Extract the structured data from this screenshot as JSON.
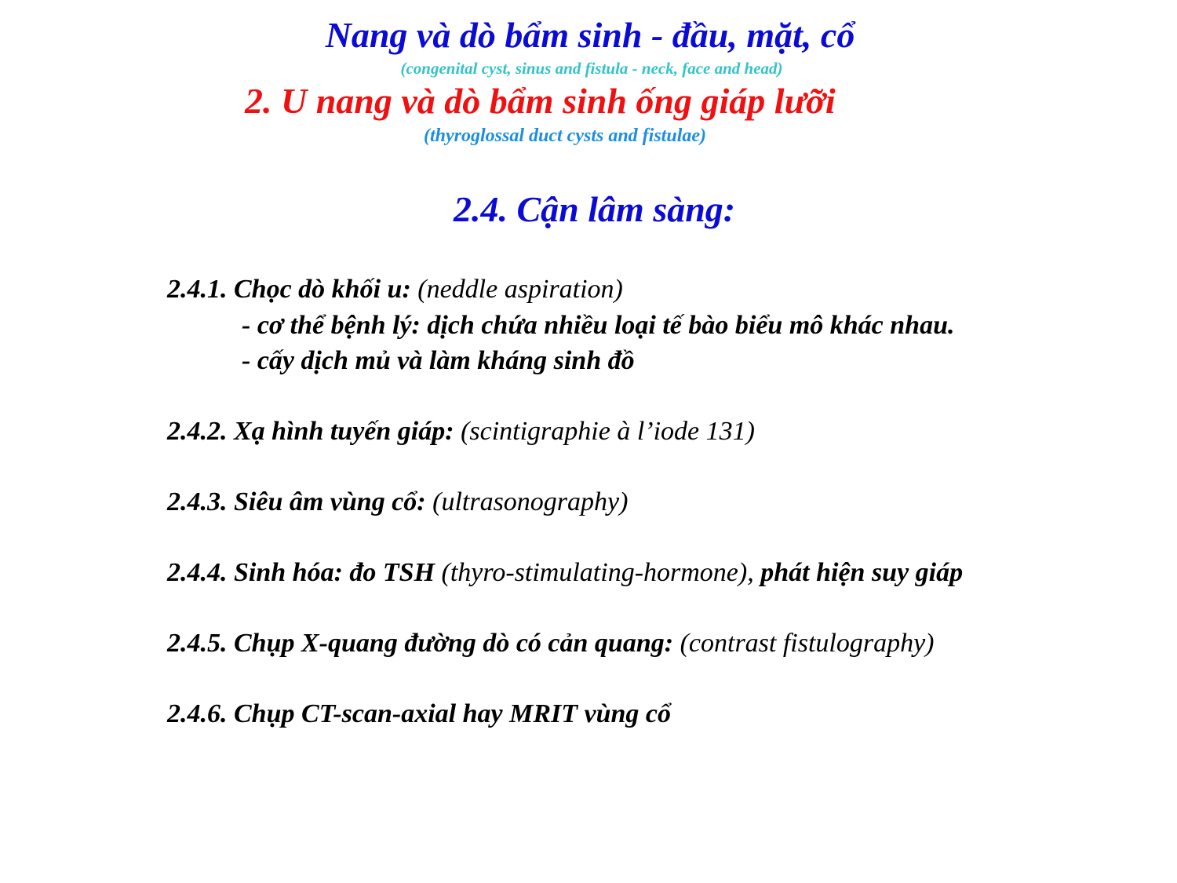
{
  "header": {
    "title": "Nang và dò bẩm sinh - đầu, mặt, cổ",
    "subtitle": "(congenital cyst, sinus and fistula - neck, face and head)"
  },
  "section": {
    "title": "2. U nang và dò bẩm sinh ống giáp lưỡi",
    "subtitle": "(thyroglossal duct cysts and fistulae)"
  },
  "subsection": {
    "title": "2.4. Cận lâm sàng:"
  },
  "items": [
    {
      "label": "2.4.1.  Chọc dò khối u:",
      "english": " (neddle aspiration)",
      "sublines": [
        "- cơ thể bệnh lý: dịch chứa nhiều loại tế bào biểu mô khác nhau.",
        "- cấy dịch mủ và làm kháng sinh đồ"
      ]
    },
    {
      "label": "2.4.2. Xạ hình tuyến giáp:",
      "english": " (scintigraphie à l’iode 131)"
    },
    {
      "label": "2.4.3. Siêu âm vùng cổ:",
      "english": " (ultrasonography)"
    },
    {
      "label": "2.4.4. Sinh hóa: đo TSH",
      "english": " (thyro-stimulating-hormone), ",
      "suffix": "phát hiện suy giáp"
    },
    {
      "label": "2.4.5. Chụp X-quang đường dò có cản quang:",
      "english": " (contrast fistulography)"
    },
    {
      "label": "2.4.6. Chụp CT-scan-axial hay MRIT vùng cổ"
    }
  ]
}
